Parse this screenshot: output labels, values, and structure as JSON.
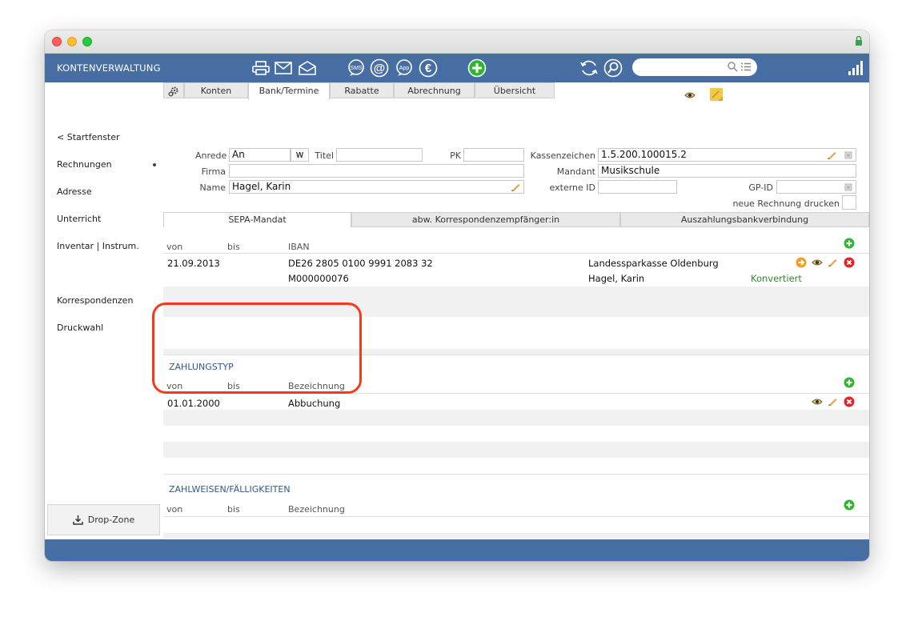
{
  "toolbar": {
    "title": "KONTENVERWALTUNG",
    "icons": [
      "printer-icon",
      "mail-icon",
      "open-mail-icon",
      "sms-icon",
      "at-icon",
      "app-icon",
      "euro-icon",
      "add-icon",
      "sync-icon",
      "search-icon",
      "bars-icon"
    ],
    "search_placeholder": ""
  },
  "sidebar": {
    "items": [
      {
        "label": "< Startfenster"
      },
      {
        "label": "Rechnungen"
      },
      {
        "label": "Adresse"
      },
      {
        "label": "Unterricht"
      },
      {
        "label": "Inventar | Instrum."
      },
      {
        "label": "Korrespondenzen"
      },
      {
        "label": "Druckwahl"
      }
    ],
    "dropzone": "Drop-Zone"
  },
  "tabs": [
    "Konten",
    "Bank/Termine",
    "Rabatte",
    "Abrechnung",
    "Übersicht"
  ],
  "form": {
    "anrede_label": "Anrede",
    "anrede_value": "An",
    "anrede_suffix": "w",
    "titel_label": "Titel",
    "titel_value": "",
    "pk_label": "PK",
    "pk_value": "",
    "firma_label": "Firma",
    "firma_value": "",
    "name_label": "Name",
    "name_value": "Hagel, Karin",
    "kassenzeichen_label": "Kassenzeichen",
    "kassenzeichen_value": "1.5.200.100015.2",
    "mandant_label": "Mandant",
    "mandant_value": "Musikschule",
    "externe_id_label": "externe ID",
    "externe_id_value": "",
    "gpid_label": "GP-ID",
    "gpid_value": "",
    "neue_rechnung_label": "neue Rechnung drucken"
  },
  "subtabs": [
    "SEPA-Mandat",
    "abw. Korrespondenzempfänger:in",
    "Auszahlungsbankverbindung"
  ],
  "sepa": {
    "headers": {
      "von": "von",
      "bis": "bis",
      "iban": "IBAN"
    },
    "row": {
      "von": "21.09.2013",
      "iban": "DE26 2805 0100 9991 2083 32",
      "mandat": "M000000076",
      "bank": "Landessparkasse Oldenburg",
      "holder": "Hagel, Karin",
      "status": "Konvertiert"
    }
  },
  "zahlungstyp": {
    "title": "ZAHLUNGSTYP",
    "headers": {
      "von": "von",
      "bis": "bis",
      "bezeichnung": "Bezeichnung"
    },
    "row": {
      "von": "01.01.2000",
      "bezeichnung": "Abbuchung"
    }
  },
  "zahlweisen": {
    "title": "ZAHLWEISEN/FÄLLIGKEITEN",
    "headers": {
      "von": "von",
      "bis": "bis",
      "bezeichnung": "Bezeichnung"
    }
  },
  "colors": {
    "toolbar": "#466ea3",
    "highlight": "#f43a1c",
    "green": "#2e8b2e",
    "section": "#2d5a8e"
  }
}
